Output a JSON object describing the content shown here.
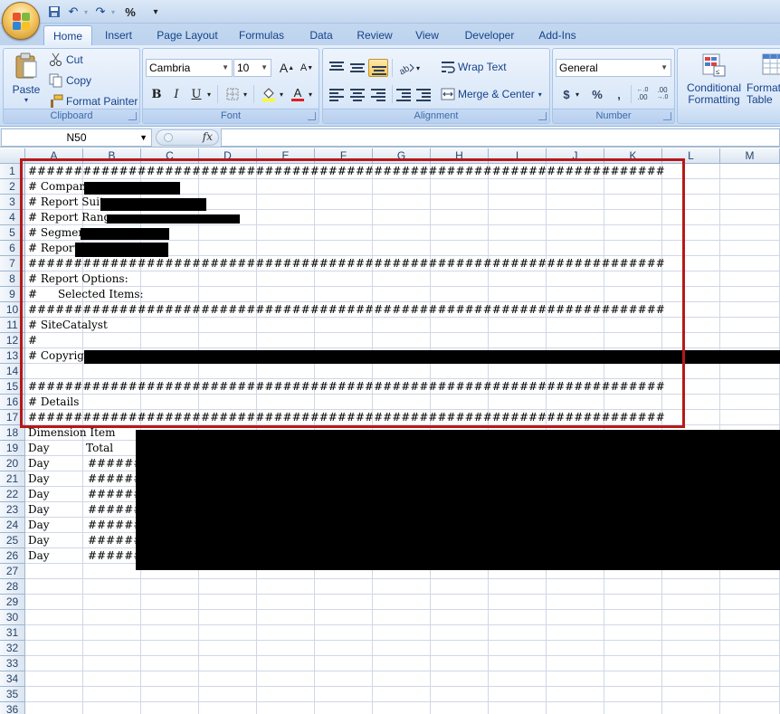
{
  "quick_access": {
    "undo": "↶",
    "redo": "↷",
    "percent": "%",
    "customize": "▾"
  },
  "tabs": [
    {
      "label": "Home",
      "active": true
    },
    {
      "label": "Insert"
    },
    {
      "label": "Page Layout"
    },
    {
      "label": "Formulas"
    },
    {
      "label": "Data"
    },
    {
      "label": "Review"
    },
    {
      "label": "View"
    },
    {
      "label": "Developer"
    },
    {
      "label": "Add-Ins"
    }
  ],
  "ribbon": {
    "clipboard": {
      "paste": "Paste",
      "cut": "Cut",
      "copy": "Copy",
      "format_painter": "Format Painter",
      "label": "Clipboard"
    },
    "font": {
      "name": "Cambria",
      "size": "10",
      "grow": "A",
      "shrink": "A",
      "bold": "B",
      "italic": "I",
      "underline": "U",
      "font_color": "A",
      "label": "Font"
    },
    "alignment": {
      "wrap_text": "Wrap Text",
      "merge_center": "Merge & Center",
      "label": "Alignment"
    },
    "number": {
      "format": "General",
      "currency": "$",
      "percent": "%",
      "comma": ",",
      "inc_decimal": ".00",
      "dec_decimal": ".00",
      "label": "Number"
    },
    "styles": {
      "conditional_formatting": "Conditional Formatting",
      "format_as_table": "Format as Table"
    }
  },
  "formula_bar": {
    "name_box": "N50",
    "fx": "fx",
    "content": ""
  },
  "columns": [
    "A",
    "B",
    "C",
    "D",
    "E",
    "F",
    "G",
    "H",
    "I",
    "J",
    "K",
    "L",
    "M"
  ],
  "rows": [
    "1",
    "2",
    "3",
    "4",
    "5",
    "6",
    "7",
    "8",
    "9",
    "10",
    "11",
    "12",
    "13",
    "14",
    "15",
    "16",
    "17",
    "18",
    "19",
    "20",
    "21",
    "22",
    "23",
    "24",
    "25",
    "26",
    "27",
    "28",
    "29",
    "30",
    "31",
    "32",
    "33",
    "34",
    "35",
    "36"
  ],
  "cells": {
    "r1": "######################################################################",
    "r2": "# Company:",
    "r3": "# Report Suite:",
    "r4": "# Report Range:",
    "r5": "# Segment:",
    "r6": "# Report:",
    "r7": "######################################################################",
    "r8": "# Report Options:",
    "r9": "#      Selected Items:",
    "r10": "######################################################################",
    "r11": "# SiteCatalyst",
    "r12": "#",
    "r13": "# Copyrigh",
    "r15": "######################################################################",
    "r16": "# Details",
    "r17": "######################################################################",
    "r18": "Dimension Item",
    "r19a": "Day",
    "r19b": "Total",
    "data_rows": [
      {
        "a": "Day",
        "b": "#######"
      },
      {
        "a": "Day",
        "b": "#######"
      },
      {
        "a": "Day",
        "b": "#######"
      },
      {
        "a": "Day",
        "b": "#######"
      },
      {
        "a": "Day",
        "b": "#######"
      },
      {
        "a": "Day",
        "b": "#######"
      },
      {
        "a": "Day",
        "b": "#######"
      }
    ]
  },
  "colors": {
    "highlight_box": "#b81818",
    "redaction": "#000000",
    "grid_line": "#d0d7e5",
    "header_bg": "#dbe5f1"
  }
}
